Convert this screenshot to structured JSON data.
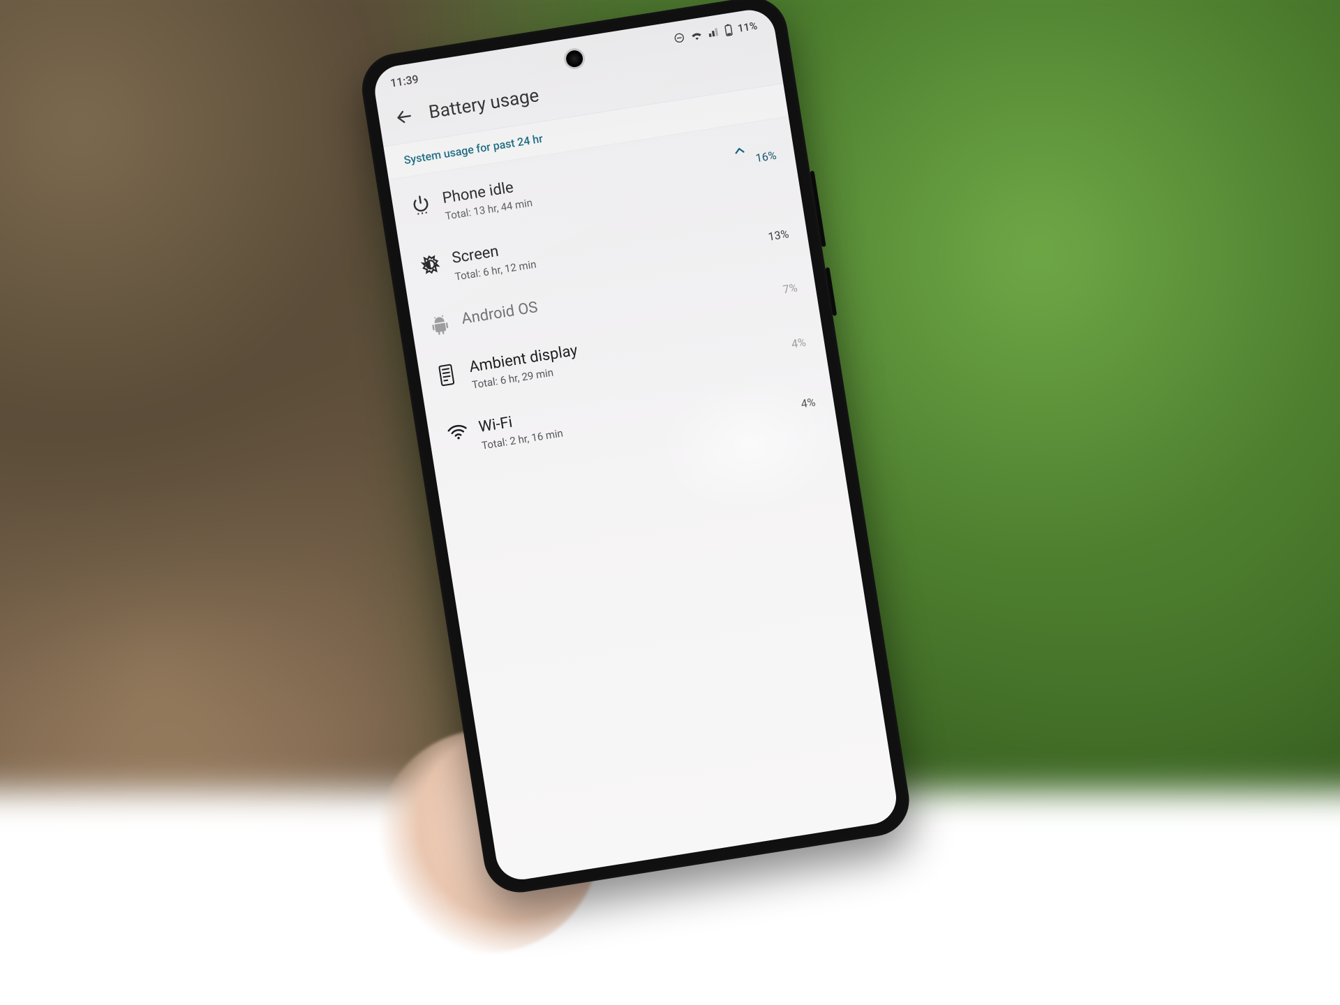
{
  "status_bar": {
    "time": "11:39",
    "battery_text": "11%"
  },
  "header": {
    "title": "Battery usage"
  },
  "section_label": "System usage for past 24 hr",
  "items": [
    {
      "name": "Phone idle",
      "sub": "Total: 13 hr, 44 min",
      "pct": "16%",
      "icon": "power",
      "expanded": true
    },
    {
      "name": "Screen",
      "sub": "Total: 6 hr, 12 min",
      "pct": "13%",
      "icon": "brightness"
    },
    {
      "name": "Android OS",
      "sub": "",
      "pct": "7%",
      "icon": "android"
    },
    {
      "name": "Ambient display",
      "sub": "Total: 6 hr, 29 min",
      "pct": "4%",
      "icon": "device"
    },
    {
      "name": "Wi-Fi",
      "sub": "Total: 2 hr, 16 min",
      "pct": "4%",
      "icon": "wifi"
    }
  ]
}
